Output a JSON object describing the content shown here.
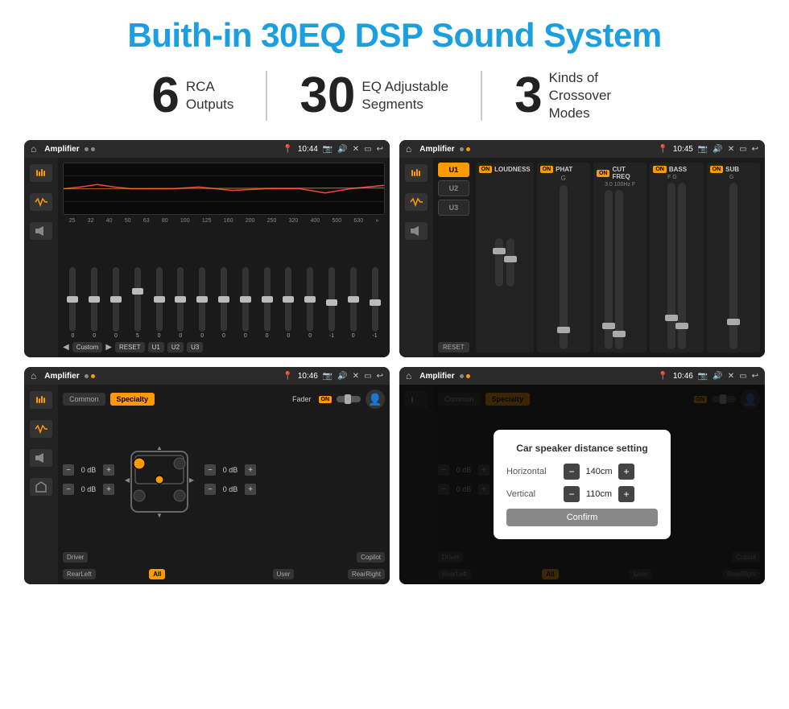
{
  "title": "Buith-in 30EQ DSP Sound System",
  "stats": [
    {
      "number": "6",
      "label": "RCA\nOutputs"
    },
    {
      "number": "30",
      "label": "EQ Adjustable\nSegments"
    },
    {
      "number": "3",
      "label": "Kinds of\nCrossover Modes"
    }
  ],
  "screens": [
    {
      "id": "eq-screen",
      "topbar": {
        "time": "10:44",
        "title": "Amplifier"
      },
      "eq_freqs": [
        "25",
        "32",
        "40",
        "50",
        "63",
        "80",
        "100",
        "125",
        "160",
        "200",
        "250",
        "320",
        "400",
        "500",
        "630"
      ],
      "eq_values": [
        "0",
        "0",
        "0",
        "5",
        "0",
        "0",
        "0",
        "0",
        "0",
        "0",
        "0",
        "0",
        "-1",
        "0",
        "-1"
      ],
      "eq_buttons": [
        "Custom",
        "RESET",
        "U1",
        "U2",
        "U3"
      ]
    },
    {
      "id": "amp-screen",
      "topbar": {
        "time": "10:45",
        "title": "Amplifier"
      },
      "u_buttons": [
        "U1",
        "U2",
        "U3"
      ],
      "panels": [
        "LOUDNESS",
        "PHAT",
        "CUT FREQ",
        "BASS",
        "SUB"
      ]
    },
    {
      "id": "crossover-screen",
      "topbar": {
        "time": "10:46",
        "title": "Amplifier"
      },
      "tabs": [
        "Common",
        "Specialty"
      ],
      "fader_label": "Fader",
      "fader_on": "ON",
      "db_values": [
        "0 dB",
        "0 dB",
        "0 dB",
        "0 dB"
      ],
      "labels": [
        "Driver",
        "",
        "Copilot",
        "RearLeft",
        "All",
        "",
        "User",
        "RearRight"
      ]
    },
    {
      "id": "dialog-screen",
      "topbar": {
        "time": "10:46",
        "title": "Amplifier"
      },
      "tabs": [
        "Common",
        "Specialty"
      ],
      "dialog": {
        "title": "Car speaker distance setting",
        "rows": [
          {
            "label": "Horizontal",
            "value": "140cm"
          },
          {
            "label": "Vertical",
            "value": "110cm"
          }
        ],
        "confirm": "Confirm"
      },
      "db_values_right": [
        "0 dB",
        "0 dB"
      ],
      "labels_right": [
        "Driver",
        "",
        "Copilot",
        "RearLef...",
        "",
        "",
        "User",
        "RearRight"
      ]
    }
  ]
}
